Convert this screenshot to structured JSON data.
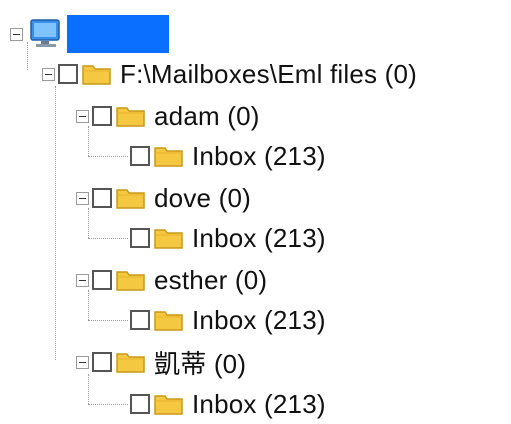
{
  "tree": {
    "root": {
      "label": ""
    },
    "folder_root": {
      "label": "F:\\Mailboxes\\Eml files (0)"
    },
    "accounts": [
      {
        "label": "adam (0)",
        "child": "Inbox (213)"
      },
      {
        "label": "dove (0)",
        "child": "Inbox (213)"
      },
      {
        "label": "esther (0)",
        "child": "Inbox (213)"
      },
      {
        "label": "凱蒂 (0)",
        "child": "Inbox (213)"
      }
    ],
    "colors": {
      "selection": "#0a6fff",
      "folder": "#f5c842",
      "folder_edge": "#c9981a"
    },
    "icons": [
      "computer-icon",
      "folder-icon",
      "checkbox",
      "collapse-icon"
    ]
  }
}
